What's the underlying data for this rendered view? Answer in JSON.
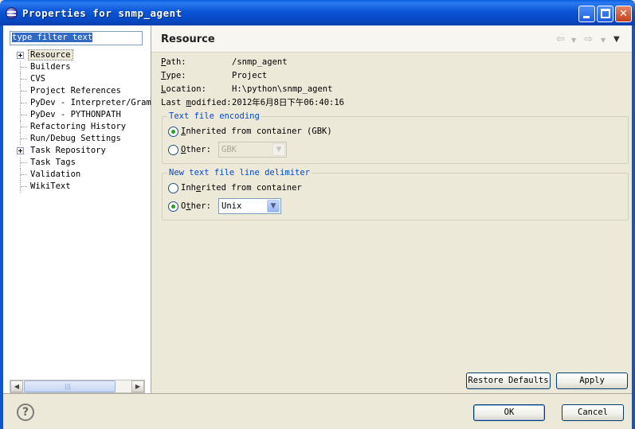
{
  "window": {
    "title": "Properties for snmp_agent",
    "minimize": "",
    "maximize": "",
    "close": "✕"
  },
  "filter": {
    "value": "type filter text"
  },
  "tree": {
    "items": [
      {
        "label": "Resource",
        "expandable": true,
        "selected": true
      },
      {
        "label": "Builders"
      },
      {
        "label": "CVS"
      },
      {
        "label": "Project References"
      },
      {
        "label": "PyDev - Interpreter/Gram"
      },
      {
        "label": "PyDev - PYTHONPATH"
      },
      {
        "label": "Refactoring History"
      },
      {
        "label": "Run/Debug Settings"
      },
      {
        "label": "Task Repository",
        "expandable": true
      },
      {
        "label": "Task Tags"
      },
      {
        "label": "Validation"
      },
      {
        "label": "WikiText"
      }
    ]
  },
  "page": {
    "title": "Resource",
    "nav_back": "⇦",
    "nav_back_dropdown": "▼",
    "nav_forward": "⇨",
    "nav_forward_dropdown": "▼",
    "view_menu": "▼",
    "info": {
      "path_key_u": "P",
      "path_key_rest": "ath:",
      "path_value": "/snmp_agent",
      "type_key_u": "T",
      "type_key_rest": "ype:",
      "type_value": "Project",
      "location_key_u": "L",
      "location_key_rest": "ocation:",
      "location_value": "H:\\python\\snmp_agent",
      "modified_key_pre": "Last ",
      "modified_key_u": "m",
      "modified_key_rest": "odified:",
      "modified_value": "2012年6月8日下午06:40:16"
    },
    "encoding": {
      "legend": "Text file encoding",
      "inherited_u": "I",
      "inherited_rest": "nherited from container (GBK)",
      "other_u": "O",
      "other_rest": "ther:",
      "other_value": "GBK"
    },
    "delimiter": {
      "legend": "New text file line delimiter",
      "inherited_pre": "Inh",
      "inherited_u": "e",
      "inherited_rest": "rited from container",
      "other_pre": "O",
      "other_u": "t",
      "other_rest": "her:",
      "other_value": "Unix"
    },
    "restore_defaults": "Restore Defaults",
    "apply": "Apply"
  },
  "footer": {
    "help": "?",
    "ok": "OK",
    "cancel": "Cancel"
  },
  "scroll": {
    "left": "◀",
    "right": "▶"
  }
}
